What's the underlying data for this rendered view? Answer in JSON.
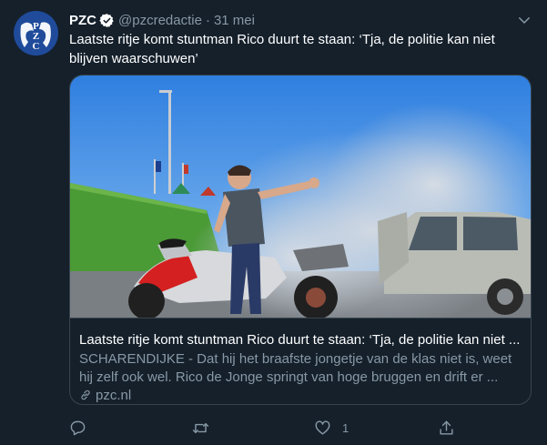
{
  "author": {
    "name": "PZC",
    "handle": "@pzcredactie",
    "separator": "·",
    "date": "31 mei",
    "avatar_text": "PZC"
  },
  "tweet": {
    "text": "Laatste ritje komt stuntman Rico duurt te staan: ‘Tja, de politie kan niet blijven waarschuwen’"
  },
  "card": {
    "title": "Laatste ritje komt stuntman Rico duurt te staan: ‘Tja, de politie kan niet ...",
    "description": "SCHARENDIJKE - Dat hij het braafste jongetje van de klas niet is, weet hij zelf ook wel. Rico de Jonge springt van hoge bruggen en drift er ...",
    "domain": "pzc.nl"
  },
  "actions": {
    "reply_count": "",
    "retweet_count": "",
    "like_count": "1",
    "share_count": ""
  },
  "icons": {
    "verified": "verified-badge-icon",
    "caret": "chevron-down-icon",
    "link": "link-icon",
    "reply": "reply-icon",
    "retweet": "retweet-icon",
    "like": "heart-icon",
    "share": "share-icon"
  },
  "colors": {
    "background": "#15202b",
    "secondary_text": "#8899a6",
    "border": "#38444d",
    "verified": "#ffffff"
  }
}
